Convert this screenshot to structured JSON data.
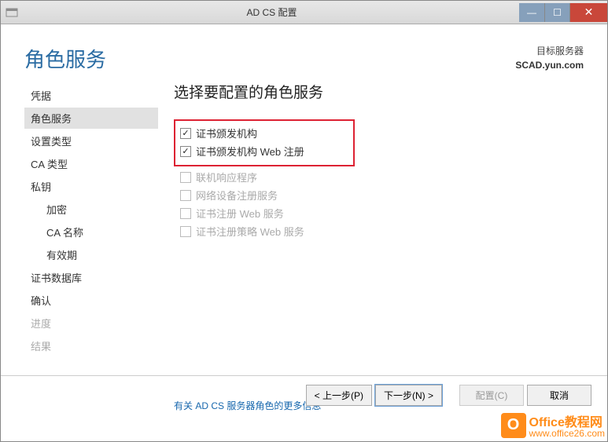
{
  "titlebar": {
    "title": "AD CS 配置"
  },
  "header": {
    "page_title": "角色服务",
    "target_label": "目标服务器",
    "target_server": "SCAD.yun.com"
  },
  "sidebar": {
    "items": [
      {
        "label": "凭据",
        "active": false,
        "sub": false,
        "disabled": false
      },
      {
        "label": "角色服务",
        "active": true,
        "sub": false,
        "disabled": false
      },
      {
        "label": "设置类型",
        "active": false,
        "sub": false,
        "disabled": false
      },
      {
        "label": "CA 类型",
        "active": false,
        "sub": false,
        "disabled": false
      },
      {
        "label": "私钥",
        "active": false,
        "sub": false,
        "disabled": false
      },
      {
        "label": "加密",
        "active": false,
        "sub": true,
        "disabled": false
      },
      {
        "label": "CA 名称",
        "active": false,
        "sub": true,
        "disabled": false
      },
      {
        "label": "有效期",
        "active": false,
        "sub": true,
        "disabled": false
      },
      {
        "label": "证书数据库",
        "active": false,
        "sub": false,
        "disabled": false
      },
      {
        "label": "确认",
        "active": false,
        "sub": false,
        "disabled": false
      },
      {
        "label": "进度",
        "active": false,
        "sub": false,
        "disabled": true
      },
      {
        "label": "结果",
        "active": false,
        "sub": false,
        "disabled": true
      }
    ]
  },
  "main": {
    "heading": "选择要配置的角色服务",
    "highlighted": [
      {
        "label": "证书颁发机构",
        "checked": true,
        "disabled": false
      },
      {
        "label": "证书颁发机构 Web 注册",
        "checked": true,
        "disabled": false
      }
    ],
    "plain": [
      {
        "label": "联机响应程序",
        "checked": false,
        "disabled": true
      },
      {
        "label": "网络设备注册服务",
        "checked": false,
        "disabled": true
      },
      {
        "label": "证书注册 Web 服务",
        "checked": false,
        "disabled": true
      },
      {
        "label": "证书注册策略 Web 服务",
        "checked": false,
        "disabled": true
      }
    ],
    "more_info": "有关 AD CS 服务器角色的更多信息"
  },
  "footer": {
    "prev": "< 上一步(P)",
    "next": "下一步(N) >",
    "configure": "配置(C)",
    "cancel": "取消"
  },
  "watermark": {
    "line1": "Office教程网",
    "line2": "www.office26.com"
  }
}
